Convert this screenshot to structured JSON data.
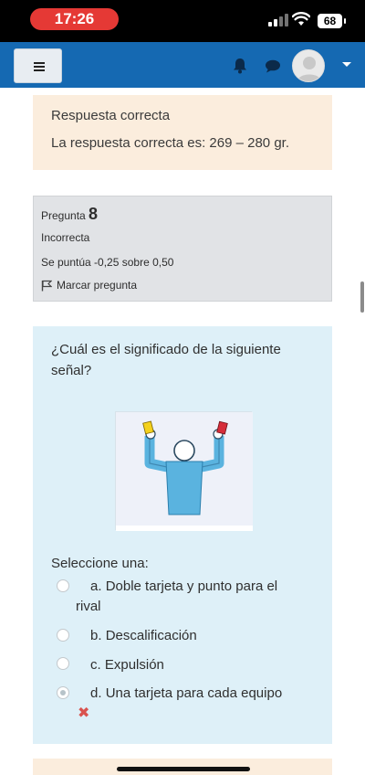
{
  "status_bar": {
    "time": "17:26",
    "battery": "68"
  },
  "navbar": {
    "menu_icon": "hamburger-icon",
    "notifications_icon": "bell-icon",
    "messages_icon": "chat-icon",
    "user_icon": "avatar",
    "dropdown_icon": "caret-down-icon",
    "brand_color": "#1569b2"
  },
  "feedback": {
    "title": "Respuesta correcta",
    "correct_answer": "La respuesta correcta es: 269 – 280 gr."
  },
  "question_info": {
    "label": "Pregunta",
    "number": "8",
    "state": "Incorrecta",
    "score": "Se puntúa -0,25 sobre 0,50",
    "flag_label": "Marcar pregunta"
  },
  "question": {
    "text": "¿Cuál es el significado de la siguiente señal?",
    "select_prompt": "Seleccione una:",
    "options": [
      {
        "letter": "a.",
        "label": "Doble tarjeta y punto para el rival",
        "selected": false
      },
      {
        "letter": "b.",
        "label": "Descalificación",
        "selected": false
      },
      {
        "letter": "c.",
        "label": "Expulsión",
        "selected": false
      },
      {
        "letter": "d.",
        "label": "Una tarjeta para cada equipo",
        "selected": true
      }
    ],
    "incorrect_mark": "✖",
    "card_colors": {
      "yellow": "#f4d11c",
      "red": "#d62d3a",
      "shirt": "#5ab3df"
    }
  }
}
